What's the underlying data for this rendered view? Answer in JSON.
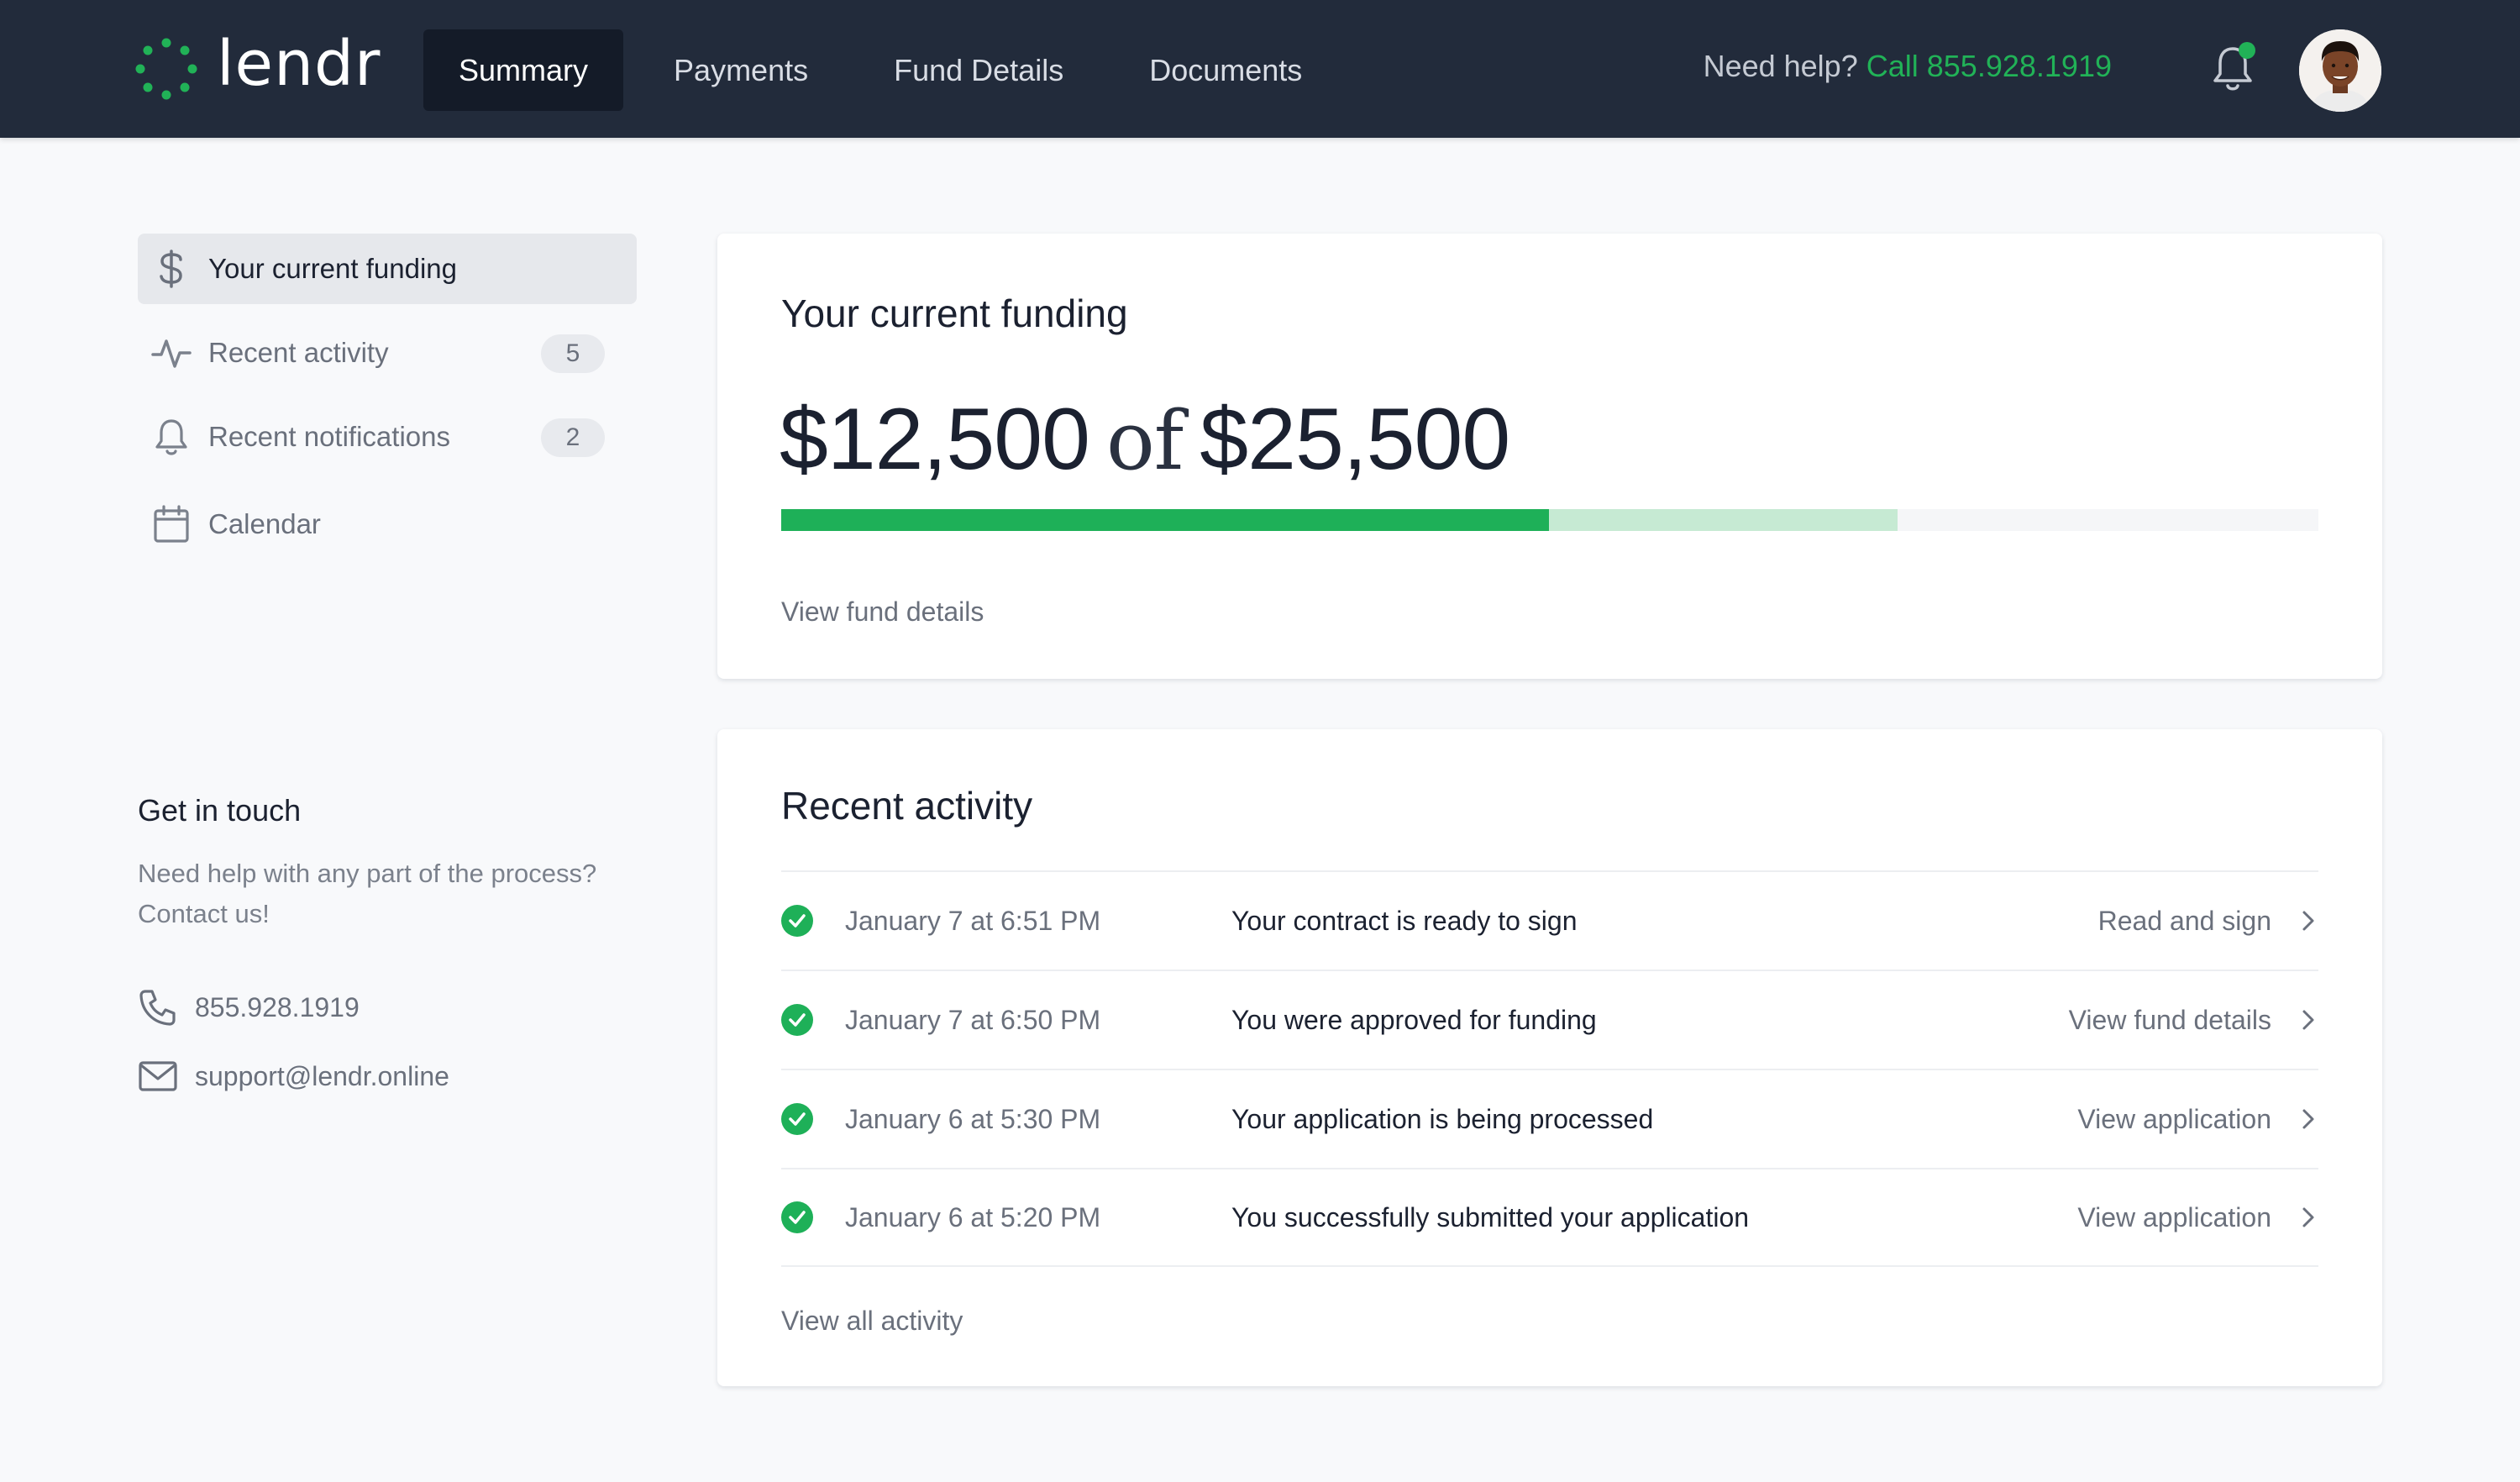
{
  "app": {
    "name": "lendr",
    "accent_color": "#21b257",
    "topbar_color": "#222b3b"
  },
  "header": {
    "logo_icon": "spinner-dots-icon",
    "nav": [
      {
        "label": "Summary",
        "active": true
      },
      {
        "label": "Payments",
        "active": false
      },
      {
        "label": "Fund Details",
        "active": false
      },
      {
        "label": "Documents",
        "active": false
      }
    ],
    "help_text": "Need help?",
    "help_phone": "Call 855.928.1919",
    "bell_icon": "bell-icon",
    "has_unread_notification": true,
    "avatar": "user-avatar"
  },
  "sidebar": {
    "items": [
      {
        "label": "Your current funding",
        "icon": "dollar-icon",
        "active": true,
        "badge": ""
      },
      {
        "label": "Recent activity",
        "icon": "activity-pulse-icon",
        "active": false,
        "badge": "5"
      },
      {
        "label": "Recent notifications",
        "icon": "bell-icon",
        "active": false,
        "badge": "2"
      },
      {
        "label": "Calendar",
        "icon": "calendar-icon",
        "active": false,
        "badge": ""
      }
    ],
    "contact": {
      "title": "Get in touch",
      "text": "Need help with any part of the process? Contact us!",
      "phone": "855.928.1919",
      "phone_icon": "phone-icon",
      "email": "support@lendr.online",
      "email_icon": "mail-icon"
    }
  },
  "funding": {
    "title": "Your current funding",
    "current": "$12,500",
    "separator": "of",
    "total": "$25,500",
    "funded_fraction": 0.4995,
    "pending_fraction": 0.7264,
    "link": "View fund details"
  },
  "activity": {
    "title": "Recent activity",
    "rows": [
      {
        "date": "January 7 at 6:51 PM",
        "message": "Your contract is ready to sign",
        "action": "Read and sign"
      },
      {
        "date": "January 7 at 6:50 PM",
        "message": "You were approved for funding",
        "action": "View fund details"
      },
      {
        "date": "January 6 at 5:30 PM",
        "message": "Your application is being processed",
        "action": "View application"
      },
      {
        "date": "January 6 at 5:20 PM",
        "message": "You successfully submitted your application",
        "action": "View application"
      }
    ],
    "link": "View all activity"
  }
}
